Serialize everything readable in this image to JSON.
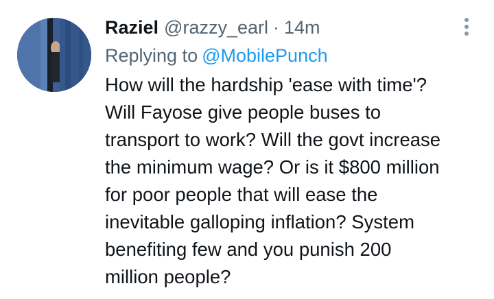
{
  "tweet": {
    "author": {
      "display_name": "Raziel",
      "handle": "@razzy_earl"
    },
    "separator": "·",
    "timestamp": "14m",
    "replying_to": {
      "prefix": "Replying to",
      "mention": "@MobilePunch"
    },
    "text_lines": [
      "How will the hardship 'ease with time'?",
      "Will Fayose give people buses to",
      "transport to work? Will the govt increase",
      "the minimum wage? Or is it $800 million",
      "for poor people that will ease the",
      "inevitable galloping inflation? System",
      "benefiting few and you punish 200",
      "million people?"
    ],
    "more_icon": "vertical-ellipsis-icon"
  },
  "colors": {
    "text_primary": "#0f1419",
    "text_secondary": "#536471",
    "link": "#1d9bf0",
    "avatar_background": "#3b5f94"
  }
}
